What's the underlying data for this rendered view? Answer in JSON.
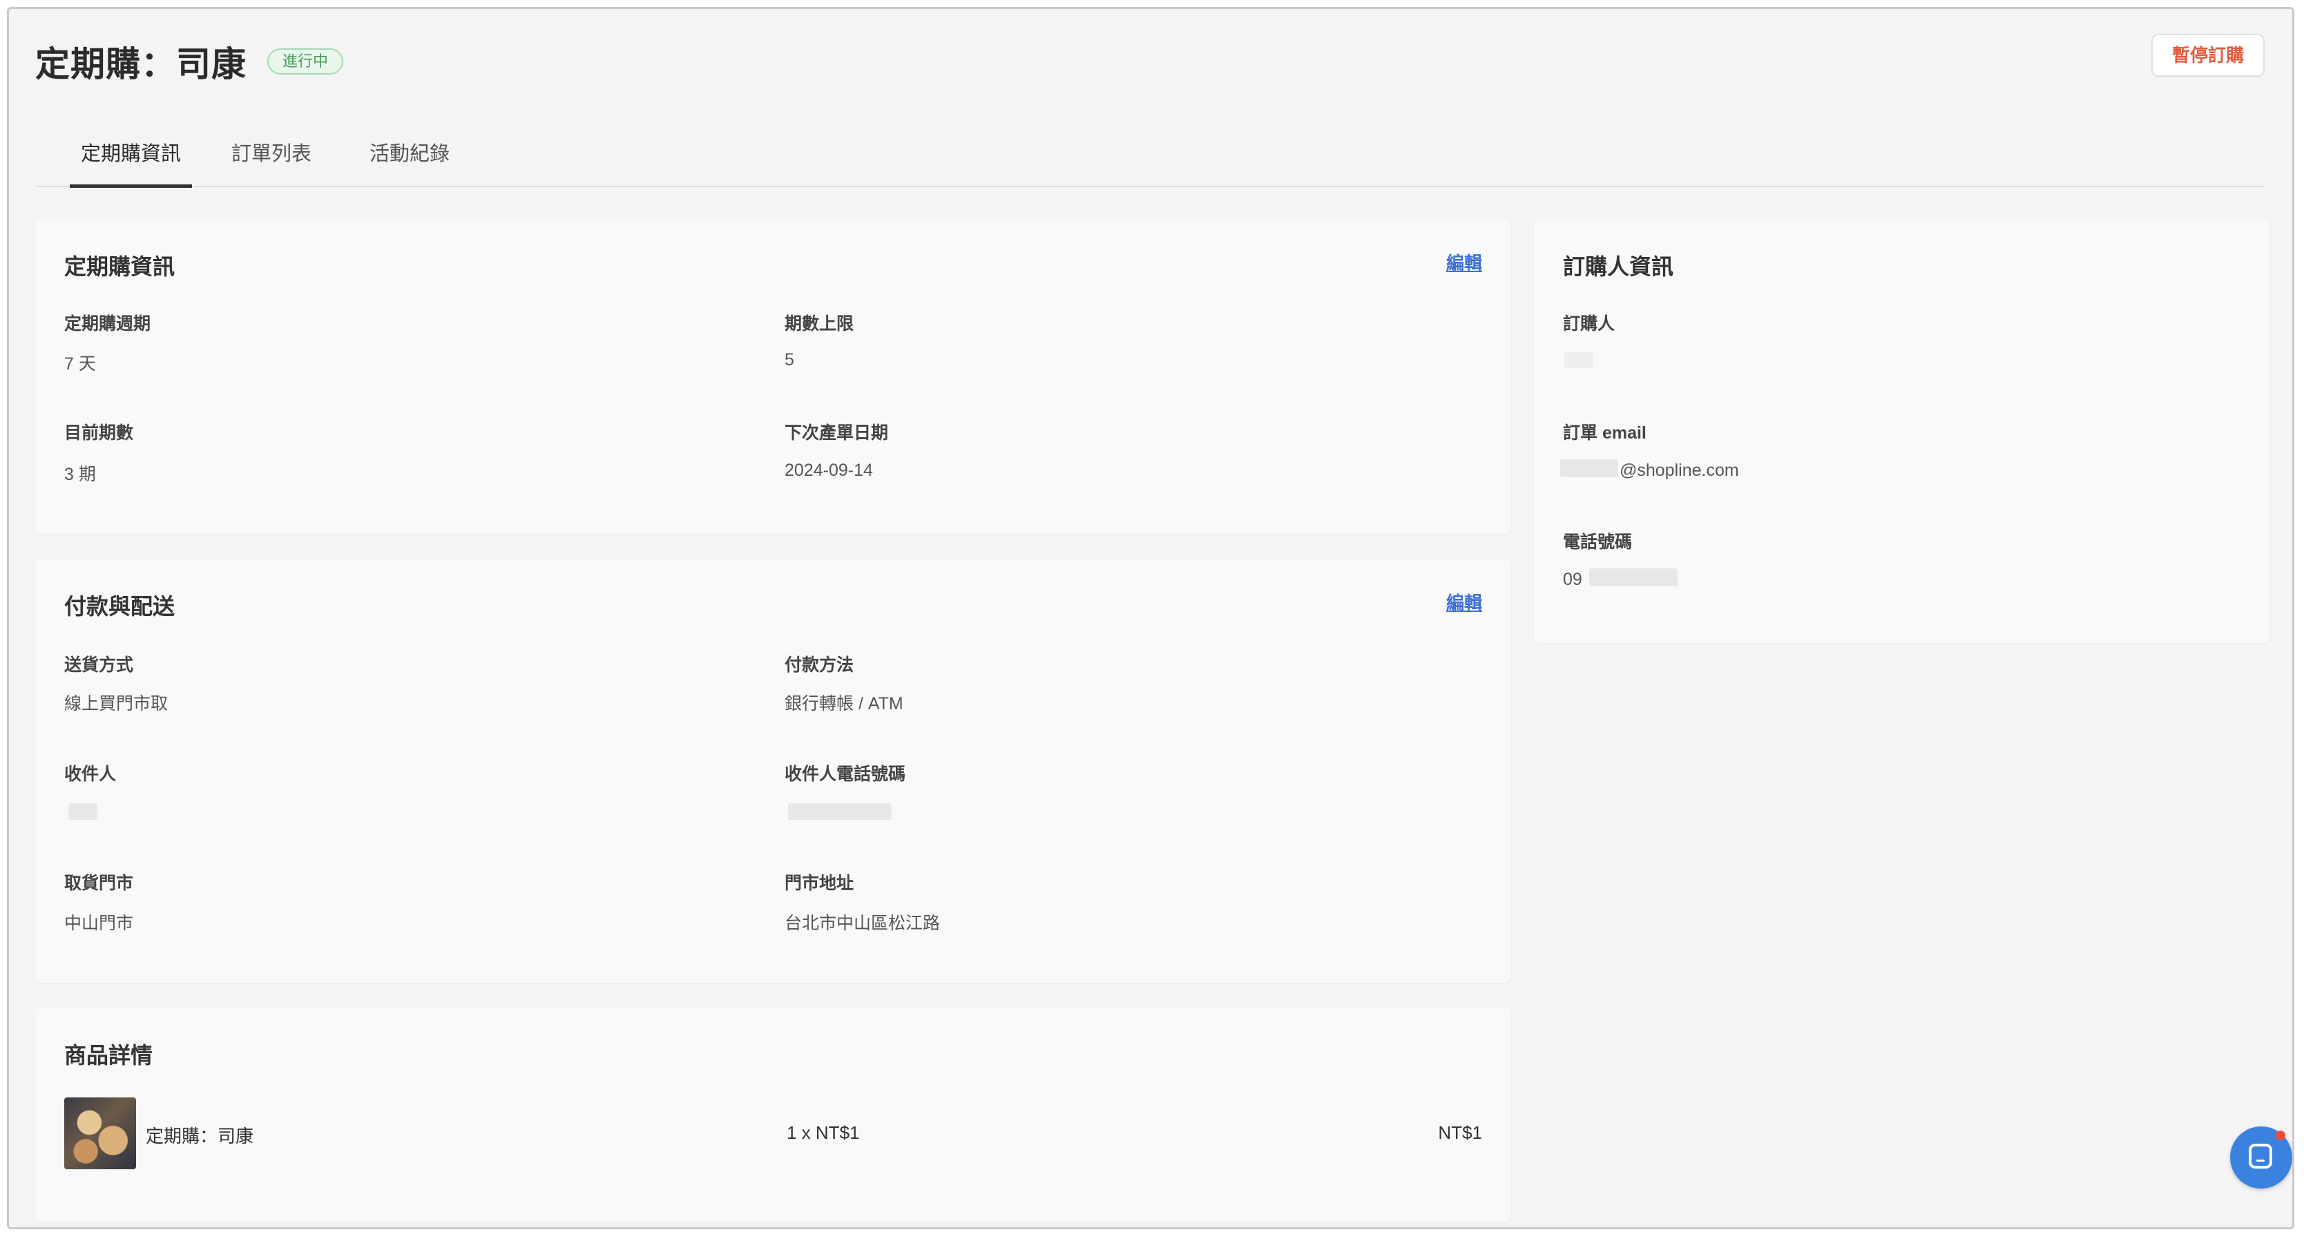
{
  "header": {
    "title": "定期購：司康",
    "status": "進行中",
    "pause_label": "暫停訂購"
  },
  "tabs": [
    {
      "label": "定期購資訊",
      "active": true
    },
    {
      "label": "訂單列表",
      "active": false
    },
    {
      "label": "活動紀錄",
      "active": false
    }
  ],
  "subscription_info": {
    "title": "定期購資訊",
    "edit_label": "編輯",
    "cycle_label": "定期購週期",
    "cycle_value": "7 天",
    "limit_label": "期數上限",
    "limit_value": "5",
    "current_label": "目前期數",
    "current_value": "3 期",
    "next_label": "下次產單日期",
    "next_value": "2024-09-14"
  },
  "payment_delivery": {
    "title": "付款與配送",
    "edit_label": "編輯",
    "delivery_label": "送貨方式",
    "delivery_value": "線上買門市取",
    "payment_label": "付款方法",
    "payment_value": "銀行轉帳 / ATM",
    "recipient_label": "收件人",
    "recipient_phone_label": "收件人電話號碼",
    "pickup_store_label": "取貨門市",
    "pickup_store_value": "中山門市",
    "store_address_label": "門市地址",
    "store_address_value": "台北市中山區松江路"
  },
  "product_details": {
    "title": "商品詳情",
    "items": [
      {
        "name": "定期購：司康",
        "qty_price": "1 x NT$1",
        "total": "NT$1"
      }
    ]
  },
  "customer_info": {
    "title": "訂購人資訊",
    "customer_label": "訂購人",
    "email_label": "訂單 email",
    "email_value": "@shopline.com",
    "phone_label": "電話號碼",
    "phone_value": "09"
  },
  "colors": {
    "accent_link": "#3b6fd6",
    "danger": "#e45a3c",
    "status_green": "#4a9a5c",
    "chat_blue": "#3b82e0"
  }
}
